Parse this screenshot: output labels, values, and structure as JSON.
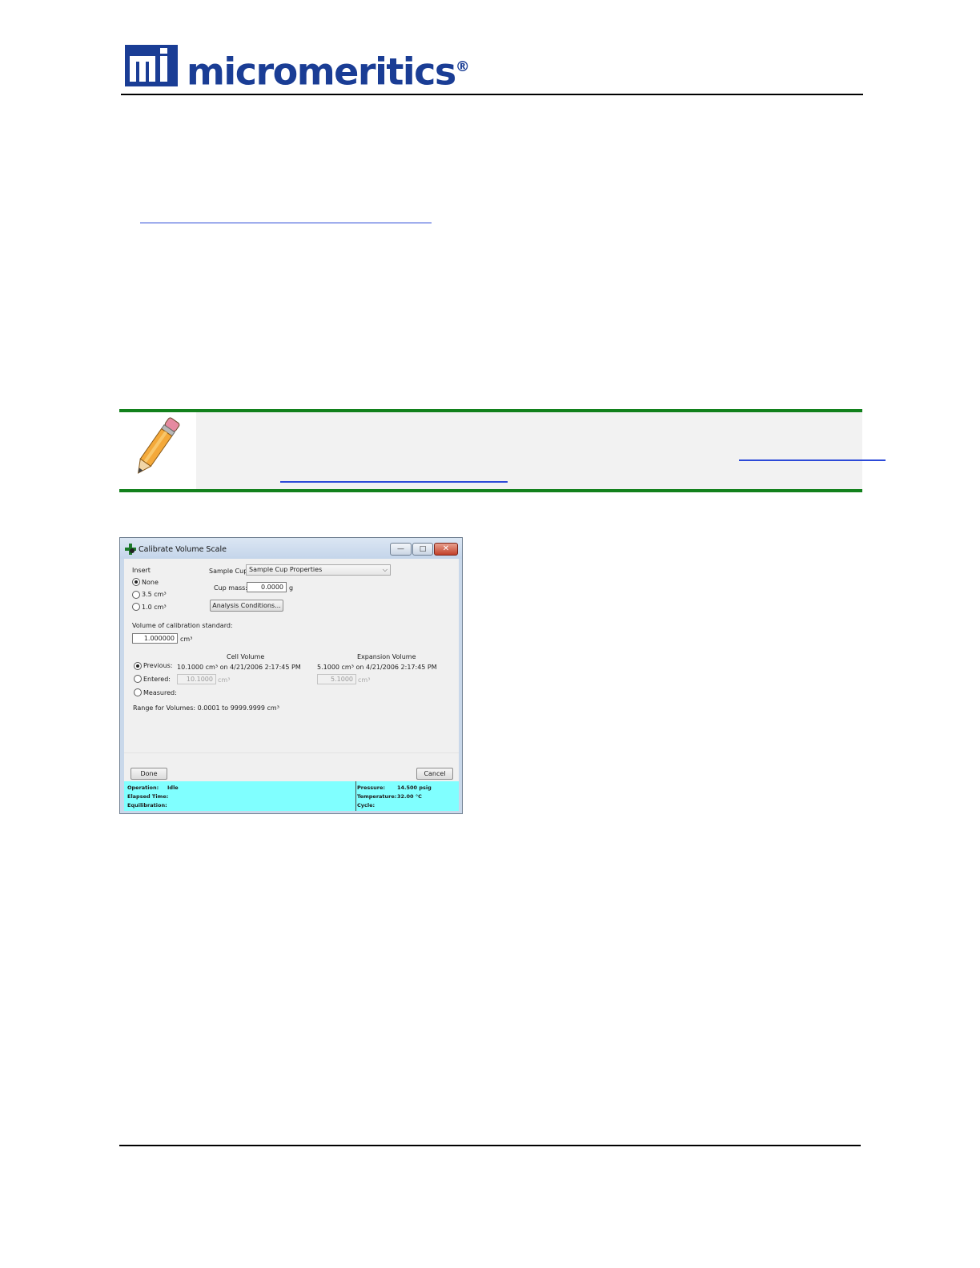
{
  "brand": {
    "mark": "mi",
    "name": "micromeritics",
    "registered": "®",
    "colors": {
      "brand_blue": "#1a3d95",
      "note_green": "#12811c",
      "link_blue": "#2c4ad8"
    }
  },
  "note": {
    "icon": "pencil-icon"
  },
  "dialog": {
    "title": "Calibrate Volume Scale",
    "window_buttons": {
      "minimize": "—",
      "maximize": "□",
      "close": "✕"
    },
    "insert": {
      "label": "Insert",
      "options": [
        {
          "label": "None",
          "selected": true
        },
        {
          "label": "3.5 cm³",
          "selected": false
        },
        {
          "label": "1.0 cm³",
          "selected": false
        }
      ]
    },
    "sample_cup": {
      "label": "Sample Cup",
      "value": "Sample Cup Properties"
    },
    "cup_mass": {
      "label": "Cup mass:",
      "value": "0.0000",
      "unit": "g"
    },
    "analysis_conditions_button": "Analysis Conditions...",
    "calibration_standard": {
      "label": "Volume of calibration standard:",
      "value": "1.000000",
      "unit": "cm³"
    },
    "cell_volume_header": "Cell Volume",
    "expansion_volume_header": "Expansion Volume",
    "previous": {
      "label": "Previous:",
      "selected": true,
      "cell": "10.1000 cm³ on 4/21/2006 2:17:45 PM",
      "expansion": "5.1000 cm³ on 4/21/2006 2:17:45 PM"
    },
    "entered": {
      "label": "Entered:",
      "selected": false,
      "cell_value": "10.1000",
      "expansion_value": "5.1000",
      "unit": "cm³"
    },
    "measured": {
      "label": "Measured:",
      "selected": false
    },
    "range_text": "Range for Volumes: 0.0001 to 9999.9999 cm³",
    "done_button": "Done",
    "cancel_button": "Cancel",
    "status": {
      "operation_label": "Operation:",
      "operation_value": "Idle",
      "elapsed_label": "Elapsed Time:",
      "equilibration_label": "Equilibration:",
      "pressure_label": "Pressure:",
      "pressure_value": "14.500 psig",
      "temperature_label": "Temperature:",
      "temperature_value": "32.00 °C",
      "cycle_label": "Cycle:",
      "status_color": "#80ffff"
    }
  }
}
